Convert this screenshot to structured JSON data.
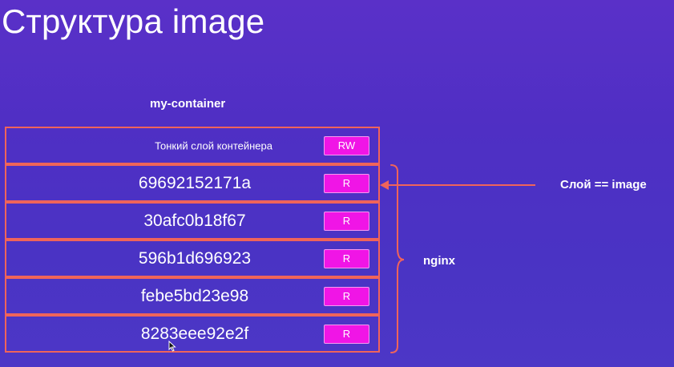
{
  "title": "Структура image",
  "container_name": "my-container",
  "layers": [
    {
      "label": "Тонкий слой контейнера",
      "badge": "RW",
      "kind": "thin"
    },
    {
      "label": "69692152171a",
      "badge": "R",
      "kind": "image"
    },
    {
      "label": "30afc0b18f67",
      "badge": "R",
      "kind": "image"
    },
    {
      "label": "596b1d696923",
      "badge": "R",
      "kind": "image"
    },
    {
      "label": "febe5bd23e98",
      "badge": "R",
      "kind": "image"
    },
    {
      "label": "8283eee92e2f",
      "badge": "R",
      "kind": "image"
    }
  ],
  "annotations": {
    "layer_equals_image": "Слой == image",
    "group_label": "nginx"
  },
  "colors": {
    "background": "#5330c6",
    "layer_border": "#f0645a",
    "badge_fill": "#f015e6",
    "text": "#ffffff"
  }
}
